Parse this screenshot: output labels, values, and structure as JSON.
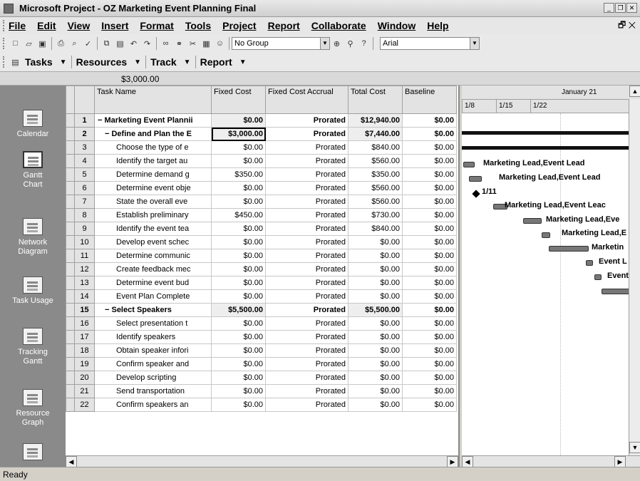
{
  "window": {
    "title": "Microsoft Project - OZ Marketing Event Planning Final"
  },
  "menu": {
    "items": [
      "File",
      "Edit",
      "View",
      "Insert",
      "Format",
      "Tools",
      "Project",
      "Report",
      "Collaborate",
      "Window",
      "Help"
    ]
  },
  "toolbar": {
    "group_value": "No Group",
    "font_value": "Arial"
  },
  "guide": {
    "tasks": "Tasks",
    "resources": "Resources",
    "track": "Track",
    "report": "Report"
  },
  "entry": {
    "value": "$3,000.00"
  },
  "viewbar": {
    "items": [
      "Calendar",
      "Gantt Chart",
      "Network Diagram",
      "Task Usage",
      "Tracking Gantt",
      "Resource Graph"
    ]
  },
  "table": {
    "headers": [
      "Task Name",
      "Fixed Cost",
      "Fixed Cost Accrual",
      "Total Cost",
      "Baseline"
    ],
    "rows": [
      {
        "id": "1",
        "name": "− Marketing Event Plannii",
        "fixed": "$0.00",
        "accrual": "Prorated",
        "total": "$12,940.00",
        "baseline": "$0.00"
      },
      {
        "id": "2",
        "name": "− Define and Plan the E",
        "fixed": "$3,000.00",
        "accrual": "Prorated",
        "total": "$7,440.00",
        "baseline": "$0.00"
      },
      {
        "id": "3",
        "name": "Choose the type of e",
        "fixed": "$0.00",
        "accrual": "Prorated",
        "total": "$840.00",
        "baseline": "$0.00"
      },
      {
        "id": "4",
        "name": "Identify the target au",
        "fixed": "$0.00",
        "accrual": "Prorated",
        "total": "$560.00",
        "baseline": "$0.00"
      },
      {
        "id": "5",
        "name": "Determine demand g",
        "fixed": "$350.00",
        "accrual": "Prorated",
        "total": "$350.00",
        "baseline": "$0.00"
      },
      {
        "id": "6",
        "name": "Determine event obje",
        "fixed": "$0.00",
        "accrual": "Prorated",
        "total": "$560.00",
        "baseline": "$0.00"
      },
      {
        "id": "7",
        "name": "State the overall eve",
        "fixed": "$0.00",
        "accrual": "Prorated",
        "total": "$560.00",
        "baseline": "$0.00"
      },
      {
        "id": "8",
        "name": "Establish preliminary",
        "fixed": "$450.00",
        "accrual": "Prorated",
        "total": "$730.00",
        "baseline": "$0.00"
      },
      {
        "id": "9",
        "name": "Identify the event tea",
        "fixed": "$0.00",
        "accrual": "Prorated",
        "total": "$840.00",
        "baseline": "$0.00"
      },
      {
        "id": "10",
        "name": "Develop event schec",
        "fixed": "$0.00",
        "accrual": "Prorated",
        "total": "$0.00",
        "baseline": "$0.00"
      },
      {
        "id": "11",
        "name": "Determine communic",
        "fixed": "$0.00",
        "accrual": "Prorated",
        "total": "$0.00",
        "baseline": "$0.00"
      },
      {
        "id": "12",
        "name": "Create feedback mec",
        "fixed": "$0.00",
        "accrual": "Prorated",
        "total": "$0.00",
        "baseline": "$0.00"
      },
      {
        "id": "13",
        "name": "Determine event bud",
        "fixed": "$0.00",
        "accrual": "Prorated",
        "total": "$0.00",
        "baseline": "$0.00"
      },
      {
        "id": "14",
        "name": "Event Plan Complete",
        "fixed": "$0.00",
        "accrual": "Prorated",
        "total": "$0.00",
        "baseline": "$0.00"
      },
      {
        "id": "15",
        "name": "− Select Speakers",
        "fixed": "$5,500.00",
        "accrual": "Prorated",
        "total": "$5,500.00",
        "baseline": "$0.00"
      },
      {
        "id": "16",
        "name": "Select presentation t",
        "fixed": "$0.00",
        "accrual": "Prorated",
        "total": "$0.00",
        "baseline": "$0.00"
      },
      {
        "id": "17",
        "name": "Identify speakers",
        "fixed": "$0.00",
        "accrual": "Prorated",
        "total": "$0.00",
        "baseline": "$0.00"
      },
      {
        "id": "18",
        "name": "Obtain speaker infori",
        "fixed": "$0.00",
        "accrual": "Prorated",
        "total": "$0.00",
        "baseline": "$0.00"
      },
      {
        "id": "19",
        "name": "Confirm speaker and",
        "fixed": "$0.00",
        "accrual": "Prorated",
        "total": "$0.00",
        "baseline": "$0.00"
      },
      {
        "id": "20",
        "name": "Develop scripting",
        "fixed": "$0.00",
        "accrual": "Prorated",
        "total": "$0.00",
        "baseline": "$0.00"
      },
      {
        "id": "21",
        "name": "Send transportation",
        "fixed": "$0.00",
        "accrual": "Prorated",
        "total": "$0.00",
        "baseline": "$0.00"
      },
      {
        "id": "22",
        "name": "Confirm speakers an",
        "fixed": "$0.00",
        "accrual": "Prorated",
        "total": "$0.00",
        "baseline": "$0.00"
      }
    ]
  },
  "gantt": {
    "month_label": "January 21",
    "week_labels": [
      "1/8",
      "1/15",
      "1/22"
    ],
    "bar_labels": [
      "Marketing Lead,Event Lead",
      "Marketing Lead,Event Lead",
      "1/11",
      "Marketing Lead,Event Leac",
      "Marketing Lead,Eve",
      "Marketing Lead,E",
      "Marketin",
      "Event L",
      "Event"
    ]
  },
  "status": {
    "text": "Ready"
  }
}
